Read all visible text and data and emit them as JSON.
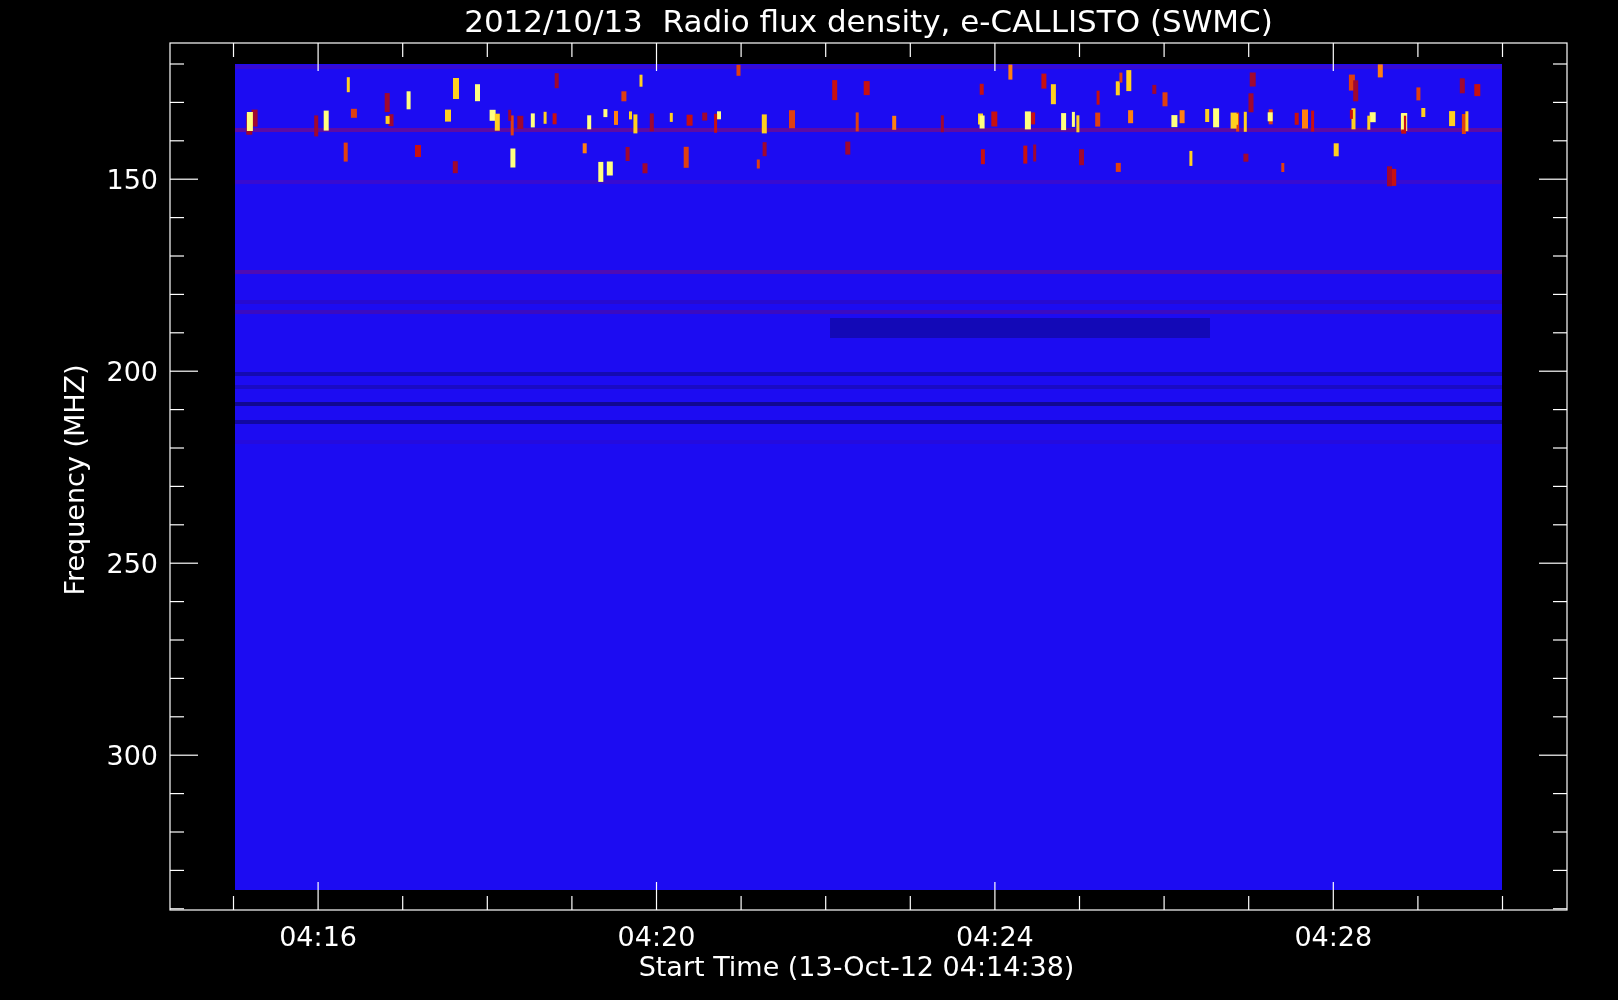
{
  "title": "2012/10/13  Radio flux density, e-CALLISTO (SWMC)",
  "plot": {
    "ylabel": "Frequency (MHZ)",
    "xlabel": "Start Time (13-Oct-12 04:14:38)",
    "yticks": [
      "150",
      "200",
      "250",
      "300"
    ],
    "xticks": [
      "04:16",
      "04:20",
      "04:24",
      "04:28"
    ]
  }
}
